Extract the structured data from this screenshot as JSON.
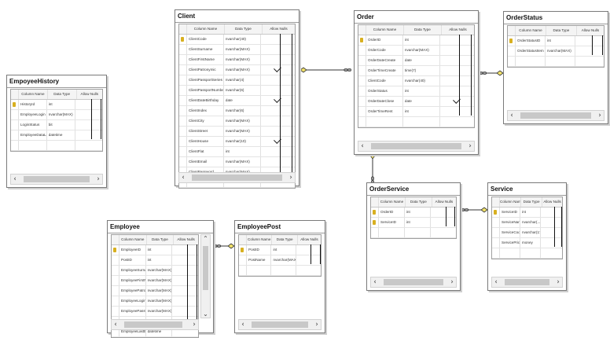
{
  "diagram": {
    "column_headers": {
      "name": "Column Name",
      "type": "Data Type",
      "nulls": "Allow Nulls"
    },
    "tables": [
      {
        "id": "emp-history",
        "title": "EmpoyeeHistory",
        "rows": [
          {
            "name": "HistoryId",
            "type": "int",
            "pk": true,
            "null": false
          },
          {
            "name": "EmployeeLogin",
            "type": "nvarchar(MAX)",
            "pk": false,
            "null": false
          },
          {
            "name": "LoginStatus",
            "type": "bit",
            "pk": false,
            "null": false
          },
          {
            "name": "EmployeeDataLo...",
            "type": "datetime",
            "pk": false,
            "null": false
          },
          {
            "name": "",
            "type": "",
            "pk": false,
            "null": false
          }
        ]
      },
      {
        "id": "client",
        "title": "Client",
        "rows": [
          {
            "name": "ClientCode",
            "type": "nvarchar(40)",
            "pk": true,
            "null": false
          },
          {
            "name": "ClientSurname",
            "type": "nvarchar(MAX)",
            "pk": false,
            "null": false
          },
          {
            "name": "ClientFirstName",
            "type": "nvarchar(MAX)",
            "pk": false,
            "null": false
          },
          {
            "name": "ClientPatronymic",
            "type": "nvarchar(MAX)",
            "pk": false,
            "null": true
          },
          {
            "name": "ClientPassportSeries",
            "type": "nvarchar(4)",
            "pk": false,
            "null": false
          },
          {
            "name": "ClientPassportNumber",
            "type": "nvarchar(6)",
            "pk": false,
            "null": false
          },
          {
            "name": "ClientDateBirthday",
            "type": "date",
            "pk": false,
            "null": true
          },
          {
            "name": "ClientIndex",
            "type": "nvarchar(6)",
            "pk": false,
            "null": false
          },
          {
            "name": "ClientCity",
            "type": "nvarchar(MAX)",
            "pk": false,
            "null": false
          },
          {
            "name": "ClientStreet",
            "type": "nvarchar(MAX)",
            "pk": false,
            "null": false
          },
          {
            "name": "ClientHouse",
            "type": "nvarchar(10)",
            "pk": false,
            "null": true
          },
          {
            "name": "ClientFlat",
            "type": "int",
            "pk": false,
            "null": false
          },
          {
            "name": "ClientEmail",
            "type": "nvarchar(MAX)",
            "pk": false,
            "null": false
          },
          {
            "name": "ClientPassword",
            "type": "nvarchar(MAX)",
            "pk": false,
            "null": false
          },
          {
            "name": "",
            "type": "",
            "pk": false,
            "null": false
          }
        ]
      },
      {
        "id": "order",
        "title": "Order",
        "rows": [
          {
            "name": "OrderID",
            "type": "int",
            "pk": true,
            "null": false
          },
          {
            "name": "OrderCode",
            "type": "nvarchar(MAX)",
            "pk": false,
            "null": false
          },
          {
            "name": "OrderDateCreate",
            "type": "date",
            "pk": false,
            "null": false
          },
          {
            "name": "OrderTimeCreate",
            "type": "time(7)",
            "pk": false,
            "null": false
          },
          {
            "name": "ClientCode",
            "type": "nvarchar(40)",
            "pk": false,
            "null": false
          },
          {
            "name": "OrderStatus",
            "type": "int",
            "pk": false,
            "null": false
          },
          {
            "name": "OrderDateClose",
            "type": "date",
            "pk": false,
            "null": true
          },
          {
            "name": "OrderTimeRent",
            "type": "int",
            "pk": false,
            "null": false
          },
          {
            "name": "",
            "type": "",
            "pk": false,
            "null": false
          }
        ]
      },
      {
        "id": "order-status",
        "title": "OrderStatus",
        "rows": [
          {
            "name": "OrderStatusID",
            "type": "int",
            "pk": true,
            "null": false
          },
          {
            "name": "OrderStatusItem",
            "type": "nvarchar(MAX)",
            "pk": false,
            "null": false
          },
          {
            "name": "",
            "type": "",
            "pk": false,
            "null": false
          }
        ]
      },
      {
        "id": "order-service",
        "title": "OrderService",
        "rows": [
          {
            "name": "OrderID",
            "type": "int",
            "pk": true,
            "null": false
          },
          {
            "name": "ServiceID",
            "type": "int",
            "pk": true,
            "null": false
          },
          {
            "name": "",
            "type": "",
            "pk": false,
            "null": false
          }
        ]
      },
      {
        "id": "service",
        "title": "Service",
        "rows": [
          {
            "name": "ServiceID",
            "type": "int",
            "pk": true,
            "null": false
          },
          {
            "name": "ServiceName",
            "type": "nvarchar(...",
            "pk": false,
            "null": false
          },
          {
            "name": "ServiceCode",
            "type": "nvarchar(17)",
            "pk": false,
            "null": false
          },
          {
            "name": "ServicePrice",
            "type": "money",
            "pk": false,
            "null": false
          },
          {
            "name": "",
            "type": "",
            "pk": false,
            "null": false
          }
        ]
      },
      {
        "id": "employee",
        "title": "Employee",
        "rows": [
          {
            "name": "EmployeeID",
            "type": "int",
            "pk": true,
            "null": false
          },
          {
            "name": "PostID",
            "type": "int",
            "pk": false,
            "null": false
          },
          {
            "name": "EmployeeSurname",
            "type": "nvarchar(MAX)",
            "pk": false,
            "null": false
          },
          {
            "name": "EmployeeFirstName",
            "type": "nvarchar(MAX)",
            "pk": false,
            "null": false
          },
          {
            "name": "EmployeePatronymic",
            "type": "nvarchar(MAX)",
            "pk": false,
            "null": false
          },
          {
            "name": "EmployeeLogin",
            "type": "nvarchar(MAX)",
            "pk": false,
            "null": false
          },
          {
            "name": "EmployeePassword",
            "type": "nvarchar(MAX)",
            "pk": false,
            "null": false
          },
          {
            "name": "EmployeeDataLogin",
            "type": "datetime",
            "pk": false,
            "null": false
          },
          {
            "name": "EmployeeLastExit",
            "type": "datetime",
            "pk": false,
            "null": false
          }
        ]
      },
      {
        "id": "employee-post",
        "title": "EmployeePost",
        "rows": [
          {
            "name": "PostID",
            "type": "int",
            "pk": true,
            "null": false
          },
          {
            "name": "PostName",
            "type": "nvarchar(MAX)",
            "pk": false,
            "null": false
          },
          {
            "name": "",
            "type": "",
            "pk": false,
            "null": false
          }
        ]
      }
    ]
  }
}
